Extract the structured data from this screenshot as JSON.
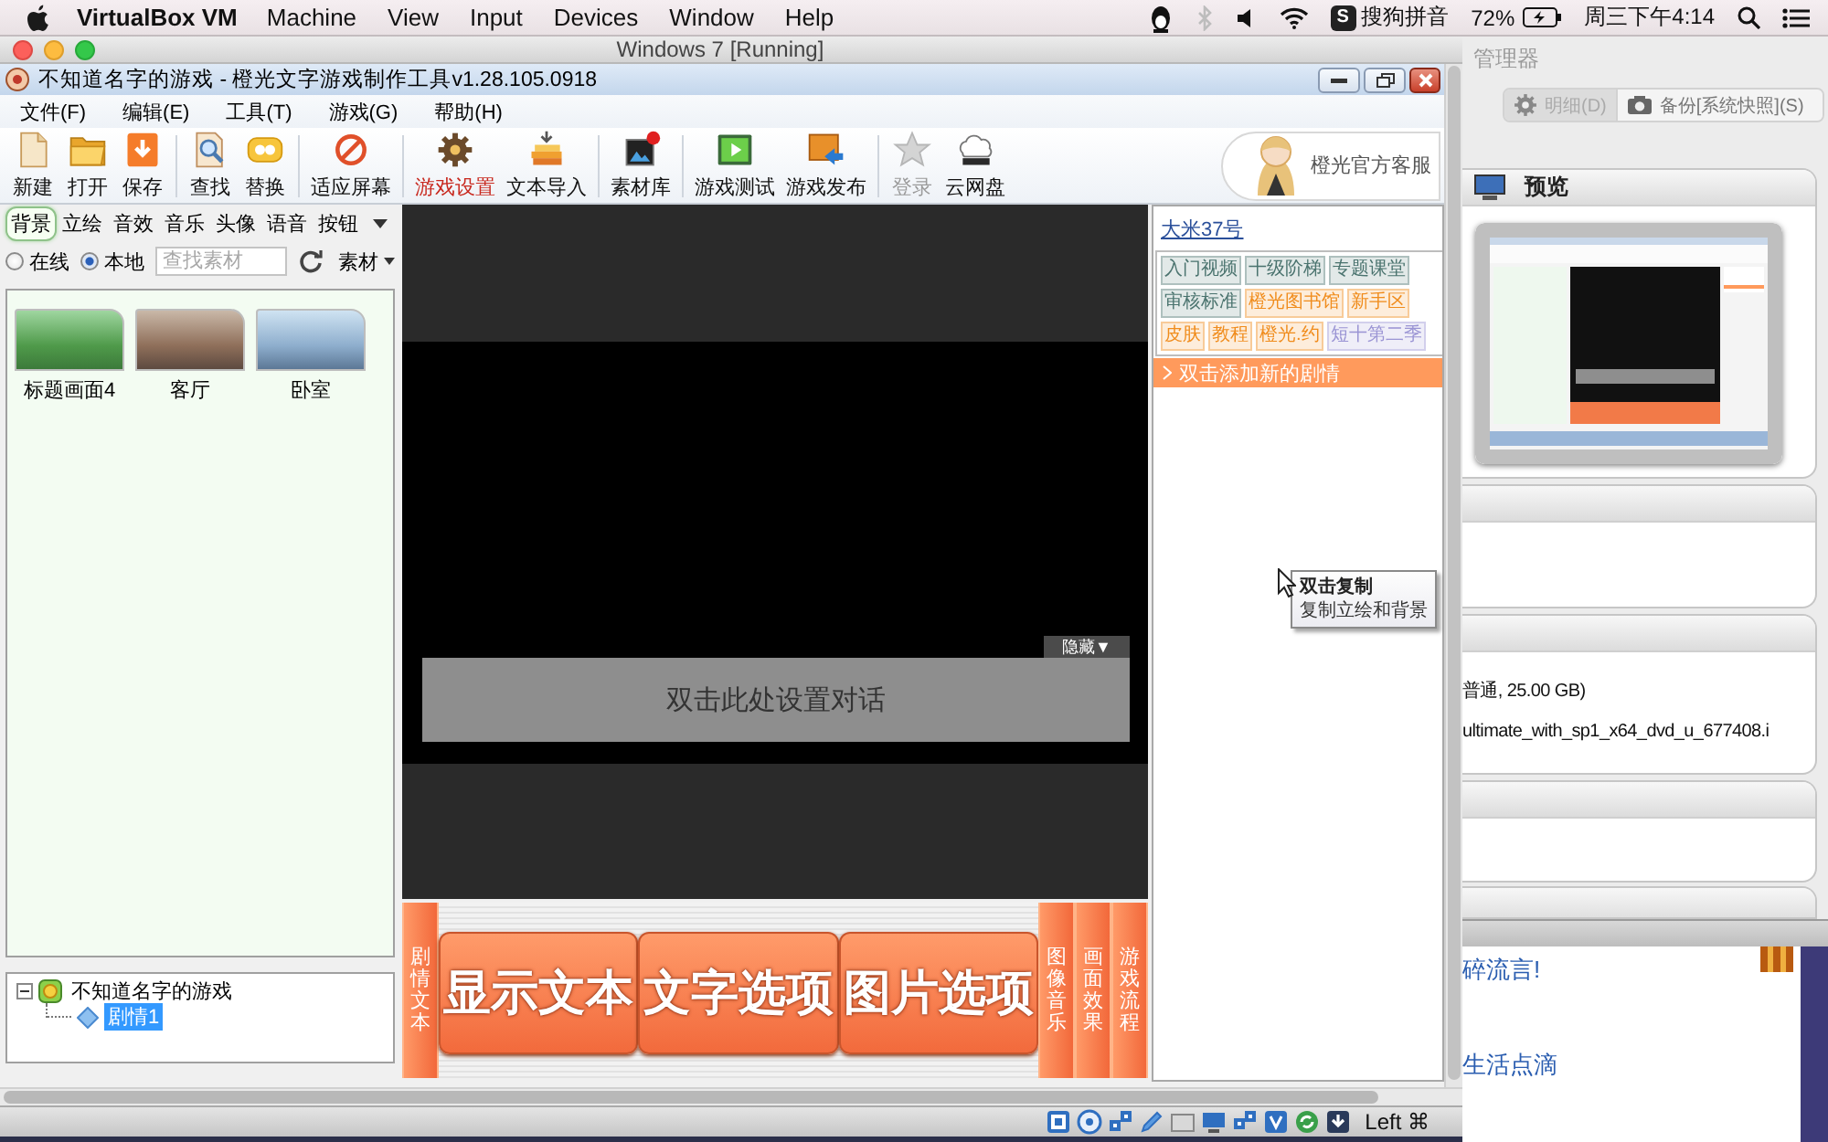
{
  "mac_menubar": {
    "app_name": "VirtualBox VM",
    "menus": [
      "Machine",
      "View",
      "Input",
      "Devices",
      "Window",
      "Help"
    ],
    "input_method": {
      "logo": "S",
      "label": "搜狗拼音"
    },
    "battery": "72%",
    "clock": "周三下午4:14"
  },
  "vm_window": {
    "title": "Windows 7 [Running]",
    "host_key": "Left ⌘"
  },
  "app": {
    "title": "不知道名字的游戏 - 橙光文字游戏制作工具v1.28.105.0918",
    "menu": [
      "文件(F)",
      "编辑(E)",
      "工具(T)",
      "游戏(G)",
      "帮助(H)"
    ],
    "toolbar": [
      [
        {
          "label": "新建",
          "highlighted": false,
          "disabled": false
        },
        {
          "label": "打开",
          "highlighted": false,
          "disabled": false
        },
        {
          "label": "保存",
          "highlighted": false,
          "disabled": false
        }
      ],
      [
        {
          "label": "查找",
          "highlighted": false,
          "disabled": false
        },
        {
          "label": "替换",
          "highlighted": false,
          "disabled": false
        }
      ],
      [
        {
          "label": "适应屏幕",
          "highlighted": false,
          "disabled": false
        }
      ],
      [
        {
          "label": "游戏设置",
          "highlighted": true,
          "disabled": false
        },
        {
          "label": "文本导入",
          "highlighted": false,
          "disabled": false
        }
      ],
      [
        {
          "label": "素材库",
          "highlighted": false,
          "disabled": false
        }
      ],
      [
        {
          "label": "游戏测试",
          "highlighted": false,
          "disabled": false
        },
        {
          "label": "游戏发布",
          "highlighted": false,
          "disabled": false
        }
      ],
      [
        {
          "label": "登录",
          "highlighted": false,
          "disabled": true
        },
        {
          "label": "云网盘",
          "highlighted": false,
          "disabled": false
        }
      ]
    ],
    "service_label": "橙光官方客服",
    "asset_tabs": [
      {
        "label": "背景",
        "selected": true
      },
      {
        "label": "立绘",
        "selected": false
      },
      {
        "label": "音效",
        "selected": false
      },
      {
        "label": "音乐",
        "selected": false
      },
      {
        "label": "头像",
        "selected": false
      },
      {
        "label": "语音",
        "selected": false
      },
      {
        "label": "按钮",
        "selected": false
      }
    ],
    "source_options": [
      {
        "label": "在线",
        "selected": false
      },
      {
        "label": "本地",
        "selected": true
      }
    ],
    "asset_search": {
      "placeholder": "查找素材"
    },
    "asset_menu": "素材",
    "assets": [
      "标题画面4",
      "客厅",
      "卧室"
    ],
    "tree": {
      "label": "不知道名字的游戏",
      "selected": false,
      "expanded": true,
      "children": [
        {
          "label": "剧情1",
          "selected": true
        }
      ]
    },
    "stage": {
      "hide_tab": "隐藏▼",
      "dialog": "双击此处设置对话"
    },
    "commands": [
      {
        "label": "剧情文本",
        "kind": "side"
      },
      {
        "label": "显示文本",
        "kind": "big"
      },
      {
        "label": "文字选项",
        "kind": "big"
      },
      {
        "label": "图片选项",
        "kind": "big"
      },
      {
        "label": "图像音乐",
        "kind": "side"
      },
      {
        "label": "画面效果",
        "kind": "side"
      },
      {
        "label": "游戏流程",
        "kind": "side"
      }
    ],
    "story_panel": {
      "user": "大米37号",
      "tags": [
        {
          "label": "入门视频",
          "color": "#4a736e"
        },
        {
          "label": "十级阶梯",
          "color": "#4a736e"
        },
        {
          "label": "专题课堂",
          "color": "#4a736e"
        },
        {
          "label": "审核标准",
          "color": "#4a736e"
        },
        {
          "label": "橙光图书馆",
          "color": "#f08c1c"
        },
        {
          "label": "新手区",
          "color": "#f08c1c"
        },
        {
          "label": "皮肤",
          "color": "#f08c1c"
        },
        {
          "label": "教程",
          "color": "#f08c1c"
        },
        {
          "label": "橙光.约",
          "color": "#f08c1c"
        },
        {
          "label": "短十第二季",
          "color": "#9a94d4"
        }
      ],
      "add_story": "双击添加新的剧情"
    },
    "tooltip": {
      "title": "双击复制",
      "text": "复制立绘和背景"
    }
  },
  "manager": {
    "title": "管理器",
    "buttons": [
      {
        "label": "明细(D)",
        "selected": true
      },
      {
        "label": "备份[系统快照](S)",
        "selected": false
      }
    ],
    "preview_title": "预览",
    "details": [
      "普通, 25.00 GB)",
      "ultimate_with_sp1_x64_dvd_u_677408.i"
    ]
  },
  "web_page": {
    "links": [
      "碎流言!",
      "生活点滴"
    ]
  }
}
